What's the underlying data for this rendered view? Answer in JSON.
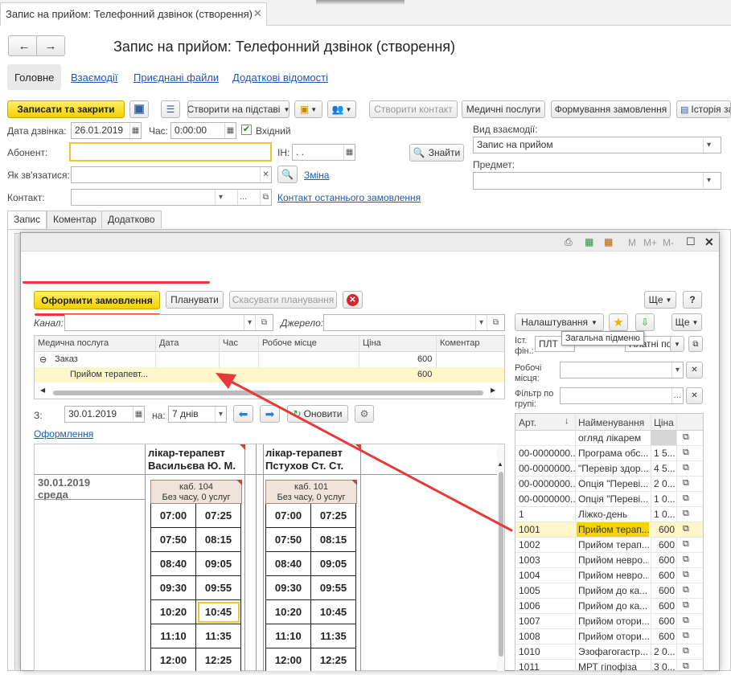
{
  "window_tab": {
    "title": "Запис на прийом: Телефонний дзвінок (створення)"
  },
  "header": {
    "title": "Запис на прийом: Телефонний дзвінок (створення)"
  },
  "nav_tabs": [
    "Головне",
    "Взаємодії",
    "Приєднані файли",
    "Додаткові відомості"
  ],
  "toolbar": {
    "save_close": "Записати та закрити",
    "create_based": "Створити на підставі",
    "create_contact": "Створити контакт",
    "med_services": "Медичні послуги",
    "order_form": "Формування замовлення",
    "history": "Історія за"
  },
  "form": {
    "call_date_label": "Дата дзвінка:",
    "call_date": "26.01.2019",
    "time_label": "Час:",
    "time": "0:00:00",
    "incoming": "Вхідний",
    "subscriber_label": "Абонент:",
    "in_label": "ІН:",
    "in_value": " .  .",
    "find": "Знайти",
    "contact_how_label": "Як зв'язатися:",
    "change": "Зміна",
    "contact_label": "Контакт:",
    "last_order": "Контакт останнього замовлення",
    "interaction_type_label": "Вид взаємодії:",
    "interaction_type": "Запис на прийом",
    "subject_label": "Предмет:"
  },
  "sub_tabs": [
    "Запис",
    "Коментар",
    "Додатково"
  ],
  "dialog": {
    "title_icons": [
      "M",
      "M+",
      "M-"
    ],
    "btn_order": "Оформити замовлення",
    "btn_plan": "Планувати",
    "btn_cancel_plan": "Скасувати планування",
    "btn_more": "Ще",
    "btn_help": "?",
    "channel_label": "Канал:",
    "source_label": "Джерело:",
    "grid_headers": [
      "Медична послуга",
      "Дата",
      "Час",
      "Робоче місце",
      "Ціна",
      "Коментар"
    ],
    "grid_group": {
      "name": "Заказ",
      "price": "600"
    },
    "grid_row": {
      "name": "Прийом терапевт...",
      "price": "600"
    },
    "from_label": "З:",
    "from_date": "30.01.2019",
    "on_label": "на:",
    "period": "7 днів",
    "refresh": "Оновити",
    "registration_link": "Оформлення",
    "day_date": "30.01.2019",
    "day_name": "среда",
    "doctors": [
      {
        "role": "лікар-терапевт",
        "name": "Васильєва Ю. М.",
        "room": "каб. 104",
        "info": "Без часу, 0 услуг",
        "slots": [
          "07:00",
          "07:25",
          "07:50",
          "08:15",
          "08:40",
          "09:05",
          "09:30",
          "09:55",
          "10:20",
          "10:45",
          "11:10",
          "11:35",
          "12:00",
          "12:25"
        ]
      },
      {
        "role": "лікар-терапевт",
        "name": "Пстухов Ст. Ст.",
        "room": "каб. 101",
        "info": "Без часу, 0 услуг",
        "slots": [
          "07:00",
          "07:25",
          "07:50",
          "08:15",
          "08:40",
          "09:05",
          "09:30",
          "09:55",
          "10:20",
          "10:45",
          "11:10",
          "11:35",
          "12:00",
          "12:25"
        ]
      }
    ]
  },
  "right_panel": {
    "settings": "Налаштування",
    "more": "Ще",
    "tooltip": "Загальна підменю",
    "fin_source_label": "Іст. фін.:",
    "fin_source": "ПЛТ",
    "fin_source2": "Платні пос",
    "workplaces_label": "Робочі місця:",
    "group_filter_label": "Фільтр по групі:",
    "headers": [
      "Арт.",
      "Найменування",
      "Ціна"
    ],
    "rows": [
      {
        "art": "",
        "name": "огляд лікарем",
        "price": ""
      },
      {
        "art": "00-0000000...",
        "name": "Програма обс...",
        "price": "1 5..."
      },
      {
        "art": "00-0000000...",
        "name": "\"Перевір здор...",
        "price": "4 5..."
      },
      {
        "art": "00-0000000...",
        "name": "Опція \"Переві...",
        "price": "2 0..."
      },
      {
        "art": "00-0000000...",
        "name": "Опція \"Переві...",
        "price": "1 0..."
      },
      {
        "art": "1",
        "name": "Ліжко-день",
        "price": "1 0..."
      },
      {
        "art": "1001",
        "name": "Прийом терап...",
        "price": "600"
      },
      {
        "art": "1002",
        "name": "Прийом терап...",
        "price": "600"
      },
      {
        "art": "1003",
        "name": "Прийом невро...",
        "price": "600"
      },
      {
        "art": "1004",
        "name": "Прийом невро...",
        "price": "600"
      },
      {
        "art": "1005",
        "name": "Прийом до ка...",
        "price": "600"
      },
      {
        "art": "1006",
        "name": "Прийом до ка...",
        "price": "600"
      },
      {
        "art": "1007",
        "name": "Прийом отори...",
        "price": "600"
      },
      {
        "art": "1008",
        "name": "Прийом отори...",
        "price": "600"
      },
      {
        "art": "1010",
        "name": "Эзофагогастр...",
        "price": "2 0..."
      },
      {
        "art": "1011",
        "name": "МРТ гіпофіза",
        "price": "3 0..."
      }
    ]
  },
  "colors": {
    "accent_yellow": "#f5d300",
    "selection": "#fdf6c8",
    "link": "#1a5ab0",
    "annotation": "#e8383a"
  }
}
